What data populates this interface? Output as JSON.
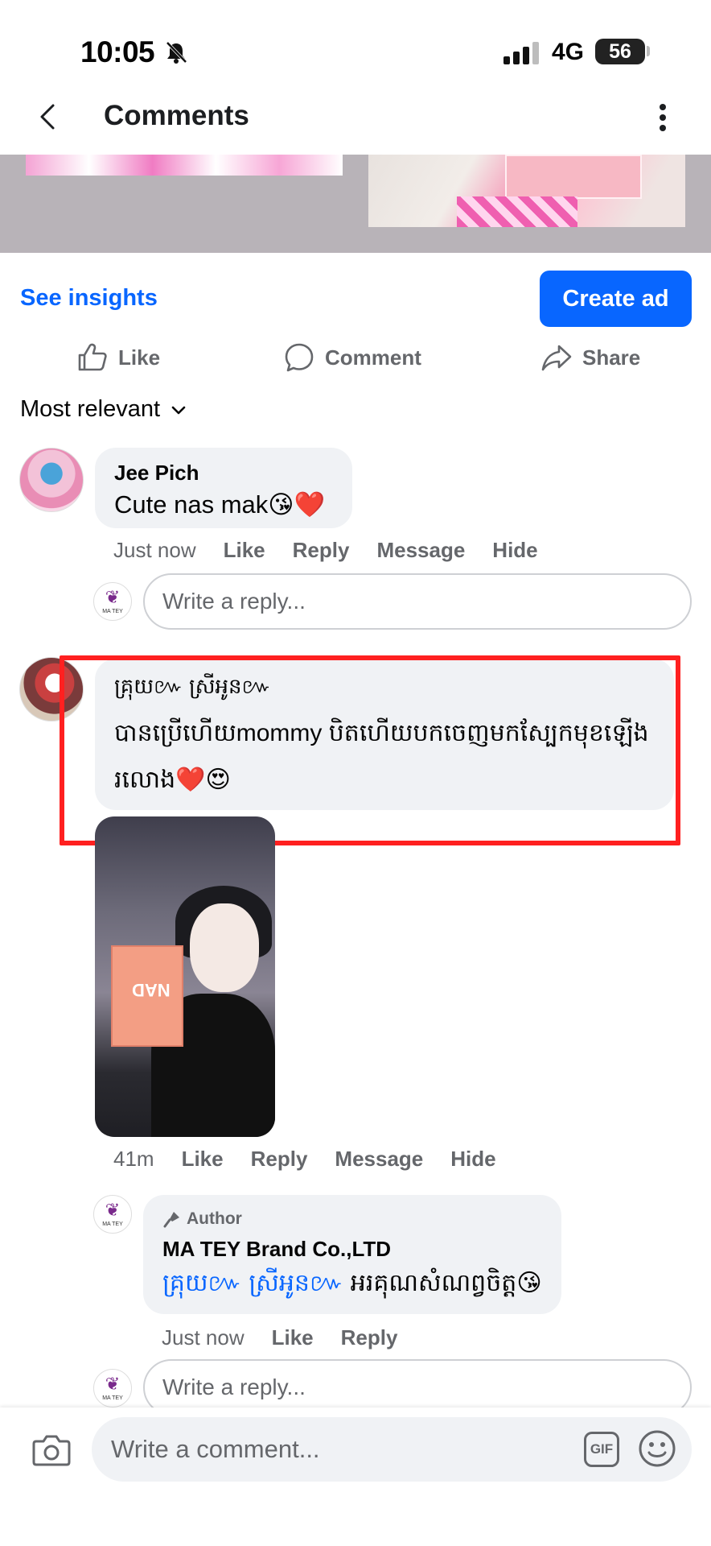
{
  "status_bar": {
    "time": "10:05",
    "network": "4G",
    "battery": "56"
  },
  "header": {
    "title": "Comments"
  },
  "post_actions": {
    "see_insights": "See insights",
    "create_ad": "Create ad",
    "like": "Like",
    "comment": "Comment",
    "share": "Share"
  },
  "sort": {
    "label": "Most relevant"
  },
  "comments": [
    {
      "author": "Jee Pich",
      "text": "Cute nas mak😘❤️",
      "time": "Just now",
      "actions": [
        "Like",
        "Reply",
        "Message",
        "Hide"
      ],
      "reply_placeholder": "Write a reply..."
    },
    {
      "author": "គ្រុយ៚ ស្រីអូន៚",
      "text": "បានប្រើហើយmommy បិតហើយបកចេញមកស្បែកមុខឡើងរលោង❤️😍",
      "time": "41m",
      "actions": [
        "Like",
        "Reply",
        "Message",
        "Hide"
      ],
      "photo_label": "NAD"
    }
  ],
  "author_reply": {
    "badge": "Author",
    "author": "MA TEY Brand Co.,LTD",
    "tag": "គ្រុយ៚ ស្រីអូន៚",
    "text": " អរគុណសំណព្វចិត្ត😘",
    "time": "Just now",
    "actions": [
      "Like",
      "Reply"
    ],
    "reply_placeholder": "Write a reply..."
  },
  "brand_logo_text": "MA TEY",
  "composer": {
    "placeholder": "Write a comment...",
    "gif_label": "GIF"
  },
  "colors": {
    "accent": "#0866ff",
    "bubble": "#f0f2f5",
    "highlight": "#ff2020",
    "muted": "#65676b"
  }
}
